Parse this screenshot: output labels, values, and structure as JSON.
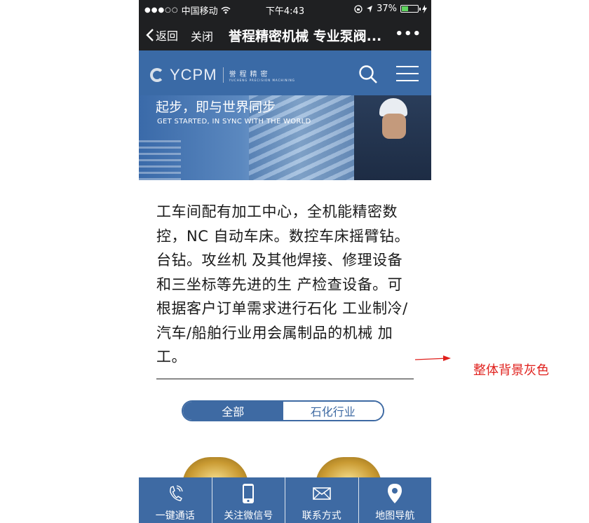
{
  "statusbar": {
    "signal_dots": "●●●○○",
    "carrier": "中国移动",
    "time": "下午4:43",
    "battery": "37%",
    "battery_level": 0.37
  },
  "navbar": {
    "back": "返回",
    "close": "关闭",
    "title": "誉程精密机械 专业泵阀...",
    "more": "•••"
  },
  "site": {
    "logo_text": "YCPM",
    "logo_cn": "誉程精密",
    "logo_en": "YUCHENG PRECISION MACHINING",
    "icons": {
      "search": "search-icon",
      "menu": "menu-icon"
    }
  },
  "banner": {
    "slogan_cn": "起步，即与世界同步",
    "slogan_en": "GET STARTED, IN SYNC WITH THE WORLD"
  },
  "intro": {
    "text": "工车间配有加工中心，全机能精密数控，NC 自动车床。数控车床摇臂钻。台钻。攻丝机 及其他焊接、修理设备和三坐标等先进的生 产检查设备。可根据客户订单需求进行石化 工业制冷/汽车/船舶行业用会属制品的机械 加工。"
  },
  "filters": [
    {
      "label": "全部",
      "active": true
    },
    {
      "label": "石化行业",
      "active": false
    }
  ],
  "tabbar": [
    {
      "label": "一键通话",
      "icon": "phone-icon"
    },
    {
      "label": "关注微信号",
      "icon": "mobile-icon"
    },
    {
      "label": "联系方式",
      "icon": "mail-icon"
    },
    {
      "label": "地图导航",
      "icon": "map-pin-icon"
    }
  ],
  "annotation": {
    "text": "整体背景灰色",
    "color": "#e0201c"
  },
  "colors": {
    "brand_blue": "#3e6aa3",
    "header_blue": "#3a6aa6",
    "wechat_bar": "#1f2022"
  }
}
